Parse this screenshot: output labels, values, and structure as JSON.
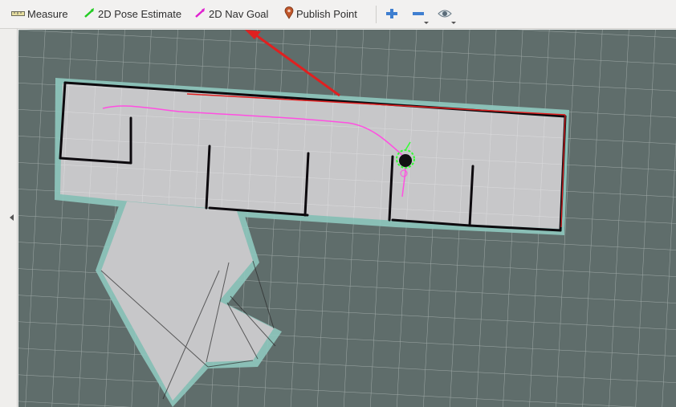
{
  "toolbar": {
    "measure_label": "Measure",
    "pose_estimate_label": "2D Pose Estimate",
    "nav_goal_label": "2D Nav Goal",
    "publish_point_label": "Publish Point",
    "icons": {
      "measure": "ruler-icon",
      "pose_estimate": "green-arrow-icon",
      "nav_goal": "magenta-arrow-icon",
      "publish_point": "map-pin-icon",
      "zoom_in": "plus-icon",
      "zoom_out": "minus-icon",
      "view": "eye-icon"
    }
  },
  "viewport": {
    "background_color": "#5f6d6b",
    "grid_color": "#9fa9a7",
    "map_free_color": "#c7c7c9",
    "map_wall_color": "#0d0a0e",
    "map_inflation_color": "#9fd3c9",
    "path_color": "#ff4fe1",
    "robot_marker_color": "#33ff33",
    "annotation_arrow_color": "#e02020"
  }
}
